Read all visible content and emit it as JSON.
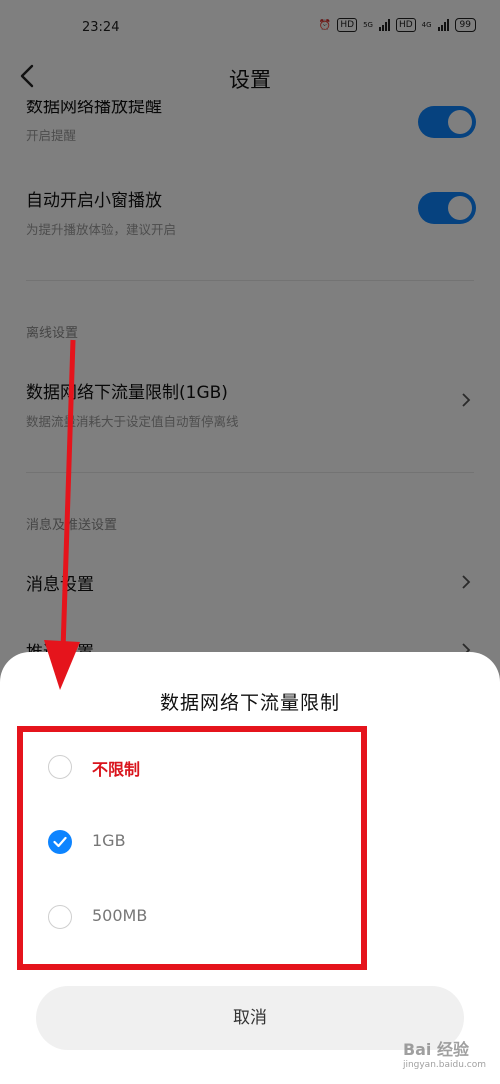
{
  "status_bar": {
    "time": "23:24",
    "net1": "HD",
    "net1_type": "5G",
    "net2": "HD",
    "net2_type": "4G",
    "battery": "99"
  },
  "header": {
    "title": "设置",
    "back_icon": "chevron-left-icon"
  },
  "settings": {
    "row_partial": {
      "main": "数据网络播放提醒",
      "sub": "开启提醒"
    },
    "row_pip": {
      "main": "自动开启小窗播放",
      "sub": "为提升播放体验，建议开启"
    },
    "section_offline": "离线设置",
    "row_data_limit": {
      "main": "数据网络下流量限制(1GB)",
      "sub": "数据流量消耗大于设定值自动暂停离线"
    },
    "section_push": "消息及推送设置",
    "row_message": {
      "main": "消息设置"
    },
    "row_partial_bottom": {
      "main": "推送设置"
    }
  },
  "sheet": {
    "title": "数据网络下流量限制",
    "options": [
      {
        "label": "不限制",
        "selected": false
      },
      {
        "label": "1GB",
        "selected": true
      },
      {
        "label": "500MB",
        "selected": false
      }
    ],
    "cancel_label": "取消"
  },
  "colors": {
    "accent": "#0d84ff",
    "annotation_red": "#e5141c"
  },
  "watermark": {
    "text": "Bai 经验",
    "sub": "jingyan.baidu.com"
  }
}
